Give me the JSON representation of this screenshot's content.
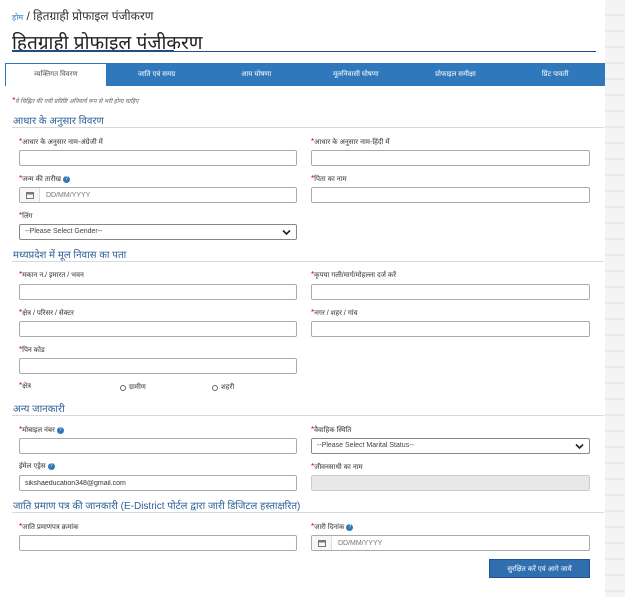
{
  "breadcrumb": {
    "home": "होम",
    "sep": " / ",
    "current": "हितग्राही प्रोफाइल पंजीकरण"
  },
  "page_title": "हितग्राही प्रोफाइल पंजीकरण",
  "tabs": [
    {
      "label": "व्यक्तिगत विवरण",
      "active": true
    },
    {
      "label": "जाति एवं समग्र"
    },
    {
      "label": "आय घोषणा"
    },
    {
      "label": "मूलनिवासी घोषणा"
    },
    {
      "label": "प्रोफाइल समीक्षा"
    },
    {
      "label": "प्रिंट पावती"
    }
  ],
  "note": "ये चिह्नित की गयी प्रविष्टि अनिवार्य रूप से भरी होना चाहिए",
  "sections": {
    "aadhaar": "आधार के अनुसार विवरण",
    "address": "मध्यप्रदेश में मूल निवास का पता",
    "other": "अन्य जानकारी",
    "caste": "जाति प्रमाण पत्र की जानकारी (E-District पोर्टल द्वारा जारी डिजिटल हस्ताक्षरित)"
  },
  "fields": {
    "name_en": {
      "label": "आधार के अनुसार नाम-अंग्रेजी में",
      "value": ""
    },
    "name_hi": {
      "label": "आधार के अनुसार नाम-हिंदी में",
      "value": ""
    },
    "dob": {
      "label": "जन्म की तारीख",
      "placeholder": "DD/MM/YYYY"
    },
    "father": {
      "label": "पिता का नाम",
      "value": ""
    },
    "gender": {
      "label": "लिंग",
      "selected": "--Please Select Gender--"
    },
    "house": {
      "label": "मकान न./ इमारत / भवन"
    },
    "street": {
      "label": "कृपया गली/मार्ग/मोहल्ला दर्ज करें"
    },
    "area": {
      "label": "क्षेत्र / परिसर / सेक्टर"
    },
    "city": {
      "label": "नगर / शहर / गांव"
    },
    "pin": {
      "label": "पिन कोड"
    },
    "region": {
      "label": "क्षेत्र",
      "options": [
        "ग्रामीण",
        "शहरी"
      ]
    },
    "mobile": {
      "label": "मोबाइल नंबर"
    },
    "marital": {
      "label": "वैवाहिक स्थिति",
      "selected": "--Please Select Marital Status--"
    },
    "email": {
      "label": "ईमेल एड्रेस",
      "value": "sikshaeducation348@gmail.com"
    },
    "spouse": {
      "label": "जीवनसाथी का नाम"
    },
    "caste_no": {
      "label": "जाति प्रमाणपत्र क्रमांक"
    },
    "issue_date": {
      "label": "जारी दिनांक",
      "placeholder": "DD/MM/YYYY"
    }
  },
  "buttons": {
    "save": "सुरक्षित करें एवं आगे जायें"
  }
}
